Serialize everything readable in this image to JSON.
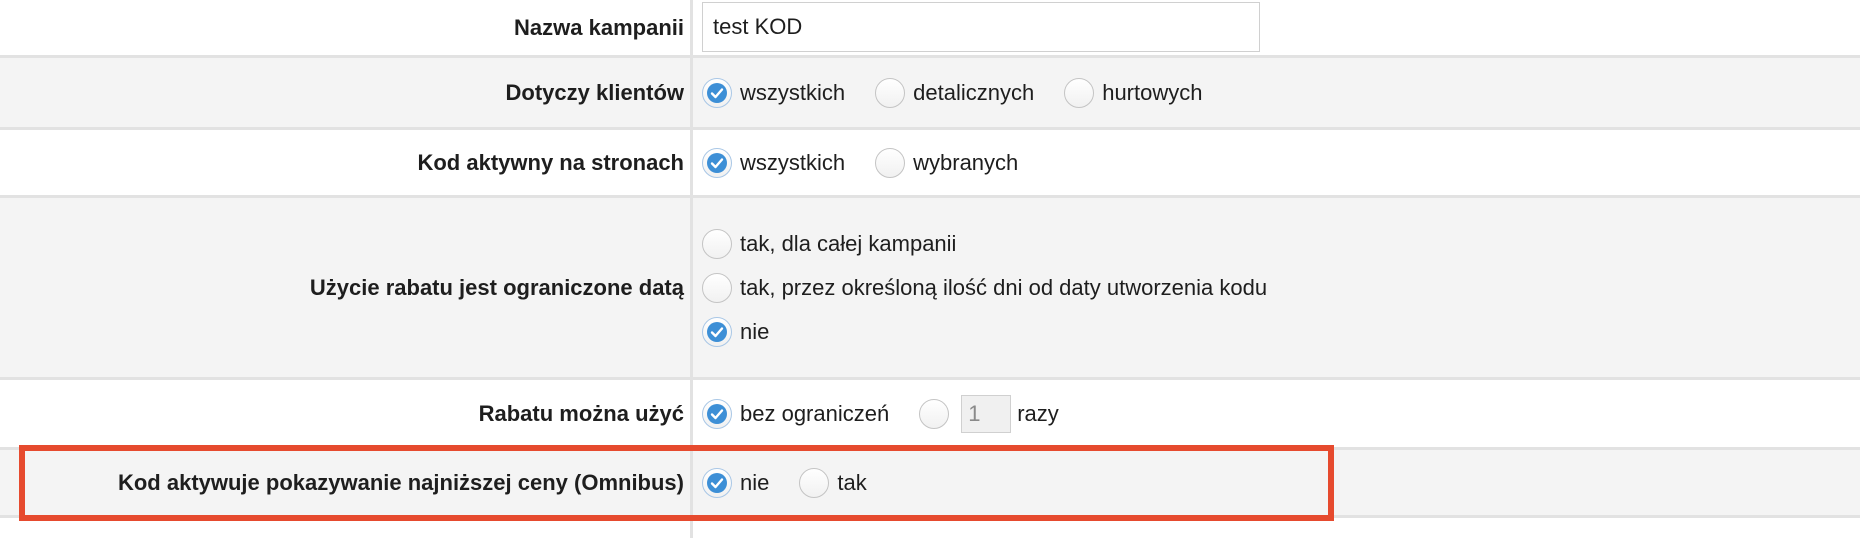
{
  "rows": {
    "campaign_name": {
      "label": "Nazwa kampanii",
      "value": "test KOD"
    },
    "applies_to": {
      "label": "Dotyczy klientów",
      "options": [
        "wszystkich",
        "detalicznych",
        "hurtowych"
      ],
      "selected": "wszystkich"
    },
    "active_on_pages": {
      "label": "Kod aktywny na stronach",
      "options": [
        "wszystkich",
        "wybranych"
      ],
      "selected": "wszystkich"
    },
    "date_limited": {
      "label": "Użycie rabatu jest ograniczone datą",
      "options": [
        "tak, dla całej kampanii",
        "tak, przez określoną ilość dni od daty utworzenia kodu",
        "nie"
      ],
      "selected": "nie"
    },
    "usage_limit": {
      "label": "Rabatu można użyć",
      "options": [
        "bez ograniczeń"
      ],
      "count_value": "1",
      "count_suffix": "razy",
      "selected": "bez ograniczeń"
    },
    "omnibus": {
      "label": "Kod aktywuje pokazywanie najniższej ceny (Omnibus)",
      "options": [
        "nie",
        "tak"
      ],
      "selected": "nie"
    }
  },
  "colors": {
    "check": "#3d8fd6",
    "highlight_border": "#e64a2e",
    "row_shade": "#f4f4f4"
  },
  "icons": {
    "radio_checked": "checkmark-icon"
  }
}
